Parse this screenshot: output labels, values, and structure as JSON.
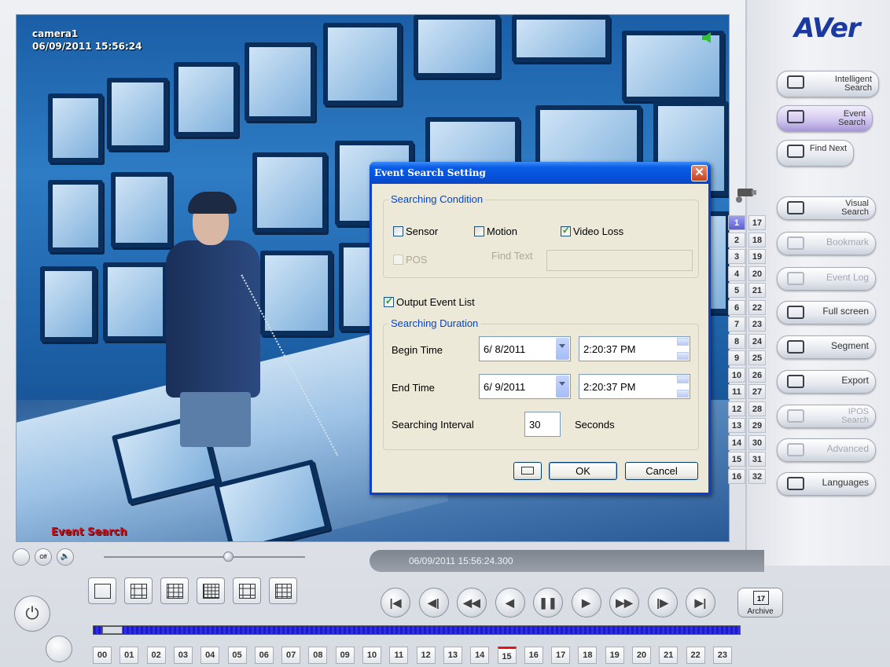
{
  "video": {
    "camera_name": "camera1",
    "timestamp": "06/09/2011 15:56:24",
    "mode_label": "Event Search"
  },
  "dialog": {
    "title": "Event Search Setting",
    "condition_legend": "Searching Condition",
    "sensor_label": "Sensor",
    "sensor_checked": false,
    "motion_label": "Motion",
    "motion_checked": false,
    "video_loss_label": "Video Loss",
    "video_loss_checked": true,
    "pos_label": "POS",
    "find_text_label": "Find Text",
    "find_text_value": "",
    "output_event_list_label": "Output Event List",
    "output_event_list_checked": true,
    "duration_legend": "Searching Duration",
    "begin_time_label": "Begin Time",
    "begin_date": "6/ 8/2011",
    "begin_time": "2:20:37 PM",
    "end_time_label": "End Time",
    "end_date": "6/ 9/2011",
    "end_time": "2:20:37 PM",
    "interval_label": "Searching Interval",
    "interval_value": "30",
    "interval_unit": "Seconds",
    "ok_label": "OK",
    "cancel_label": "Cancel"
  },
  "brand": {
    "logo": "AVer"
  },
  "side_buttons": [
    {
      "icon": "intelligent-search-icon",
      "label": "Intelligent Search",
      "state": "normal"
    },
    {
      "icon": "event-search-icon",
      "label": "Event Search",
      "state": "active"
    },
    {
      "icon": "find-next-icon",
      "label": "Find Next",
      "state": "normal"
    },
    {
      "icon": "visual-search-icon",
      "label": "Visual Search",
      "state": "normal"
    },
    {
      "icon": "bookmark-icon",
      "label": "Bookmark",
      "state": "disabled"
    },
    {
      "icon": "event-log-icon",
      "label": "Event Log",
      "state": "disabled"
    },
    {
      "icon": "full-screen-icon",
      "label": "Full screen",
      "state": "normal"
    },
    {
      "icon": "segment-icon",
      "label": "Segment",
      "state": "normal"
    },
    {
      "icon": "export-icon",
      "label": "Export",
      "state": "normal"
    },
    {
      "icon": "ipos-search-icon",
      "label": "IPOS Search",
      "state": "disabled"
    },
    {
      "icon": "advanced-icon",
      "label": "Advanced",
      "state": "disabled"
    },
    {
      "icon": "languages-icon",
      "label": "Languages",
      "state": "normal"
    }
  ],
  "cameras": {
    "left": [
      "1",
      "2",
      "3",
      "4",
      "5",
      "6",
      "7",
      "8",
      "9",
      "10",
      "11",
      "12",
      "13",
      "14",
      "15",
      "16"
    ],
    "right": [
      "17",
      "18",
      "19",
      "20",
      "21",
      "22",
      "23",
      "24",
      "25",
      "26",
      "27",
      "28",
      "29",
      "30",
      "31",
      "32"
    ],
    "active": "1"
  },
  "playback": {
    "status_time": "06/09/2011 15:56:24.300",
    "archive_label": "Archive",
    "archive_day": "17",
    "controls": [
      "first-frame",
      "prev-step",
      "fast-rewind",
      "rewind",
      "pause",
      "play",
      "fast-forward",
      "next-step",
      "last-frame"
    ],
    "layouts": [
      "1x1",
      "2x2",
      "3x3",
      "4x4",
      "1+5",
      "1+12"
    ]
  },
  "timeline": {
    "hours": [
      "00",
      "01",
      "02",
      "03",
      "04",
      "05",
      "06",
      "07",
      "08",
      "09",
      "10",
      "11",
      "12",
      "13",
      "14",
      "15",
      "16",
      "17",
      "18",
      "19",
      "20",
      "21",
      "22",
      "23"
    ],
    "current_hour": "15"
  }
}
